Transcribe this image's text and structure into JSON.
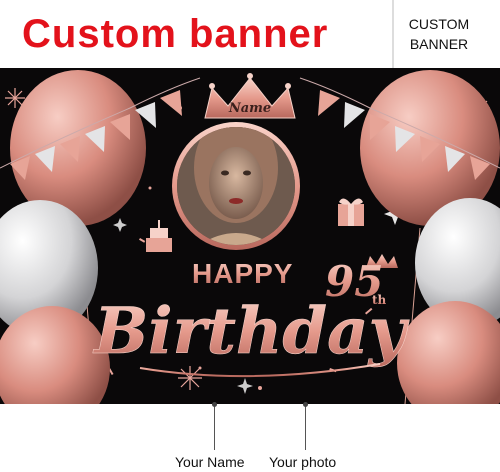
{
  "header": {
    "title": "Custom banner",
    "tag_line1": "CUSTOM",
    "tag_line2": "BANNER"
  },
  "banner": {
    "crown_text": "Name",
    "happy": "HAPPY",
    "age": "95",
    "age_suffix": "th",
    "birthday": "Birthday"
  },
  "callouts": {
    "name_label": "Your Name",
    "photo_label": "Your photo"
  },
  "colors": {
    "title": "#e3121b",
    "rose_gold": "#e8a59b",
    "background": "#0a0809"
  }
}
